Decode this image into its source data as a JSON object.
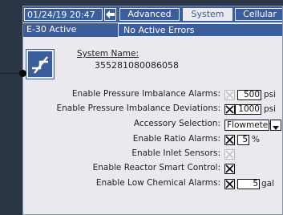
{
  "status_bar": {
    "datetime": "01/24/19 20:47",
    "tabs": [
      {
        "label": "Advanced",
        "active": false
      },
      {
        "label": "System",
        "active": true
      },
      {
        "label": "Cellular",
        "active": false
      }
    ],
    "unit_status": "E-30 Active",
    "error_status": "No Active Errors"
  },
  "system": {
    "name_label": "System Name:",
    "name_value": "355281080086058"
  },
  "settings": [
    {
      "label": "Enable Pressure Imbalance Alarms:",
      "checked": false,
      "enabled": false,
      "value": "500",
      "unit": "psi"
    },
    {
      "label": "Enable Pressure Imbalance Deviations:",
      "checked": true,
      "enabled": true,
      "value": "1000",
      "unit": "psi"
    },
    {
      "label": "Accessory Selection:",
      "type": "select",
      "value": "Flowmeter"
    },
    {
      "label": "Enable Ratio Alarms:",
      "checked": true,
      "enabled": true,
      "value": "5",
      "unit": "%"
    },
    {
      "label": "Enable Inlet Sensors:",
      "checked": false,
      "enabled": false
    },
    {
      "label": "Enable Reactor Smart Control:",
      "checked": true,
      "enabled": true
    },
    {
      "label": "Enable Low Chemical Alarms:",
      "checked": true,
      "enabled": true,
      "value": "5",
      "unit": "gal"
    }
  ],
  "colors": {
    "header": "#3b5d9c",
    "panel": "#e9e9ef",
    "background": "#2a3546"
  }
}
